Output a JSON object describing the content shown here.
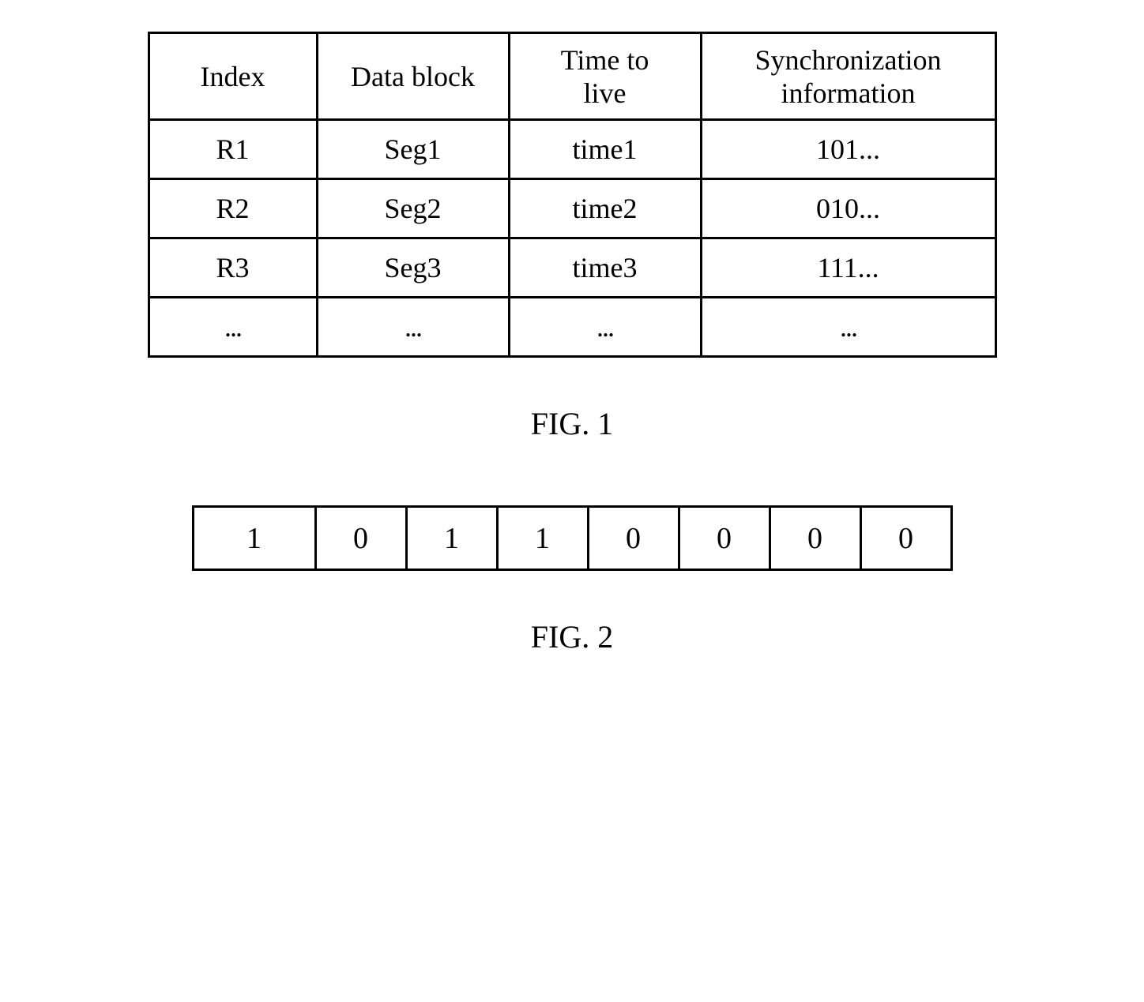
{
  "fig1": {
    "caption": "FIG. 1",
    "headers": {
      "index": "Index",
      "dataBlock": "Data block",
      "timeToLive": "Time to\nlive",
      "sync": "Synchronization\ninformation"
    },
    "rows": [
      {
        "index": "R1",
        "block": "Seg1",
        "time": "time1",
        "sync": "101..."
      },
      {
        "index": "R2",
        "block": "Seg2",
        "time": "time2",
        "sync": "010..."
      },
      {
        "index": "R3",
        "block": "Seg3",
        "time": "time3",
        "sync": "111..."
      },
      {
        "index": "...",
        "block": "...",
        "time": "...",
        "sync": "..."
      }
    ]
  },
  "fig2": {
    "caption": "FIG. 2",
    "bits": [
      "1",
      "0",
      "1",
      "1",
      "0",
      "0",
      "0",
      "0"
    ]
  }
}
